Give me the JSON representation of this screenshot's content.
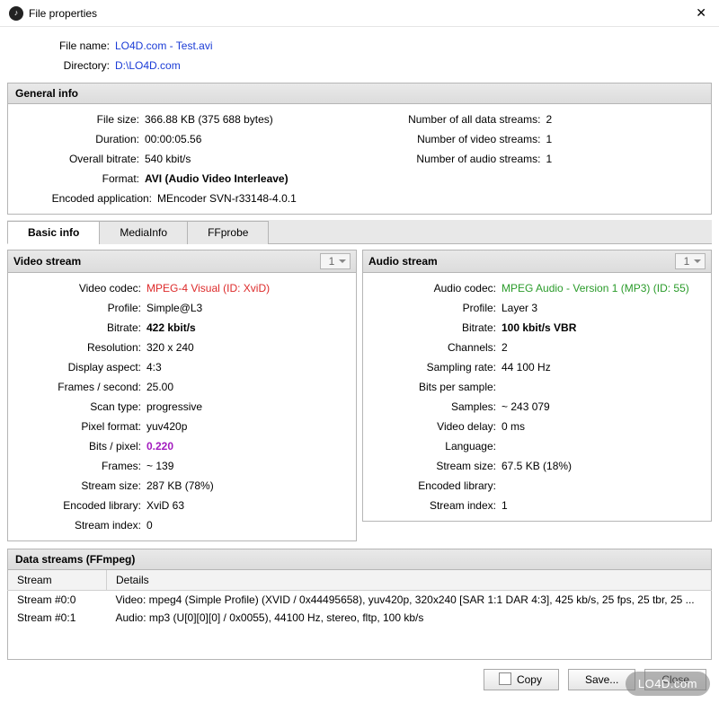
{
  "window": {
    "title": "File properties",
    "close_glyph": "✕",
    "appicon_glyph": "♪"
  },
  "file": {
    "name_label": "File name:",
    "name_value": "LO4D.com - Test.avi",
    "dir_label": "Directory:",
    "dir_value": "D:\\LO4D.com"
  },
  "general": {
    "head": "General info",
    "filesize_label": "File size:",
    "filesize_value": "366.88 KB  (375 688 bytes)",
    "duration_label": "Duration:",
    "duration_value": "00:00:05.56",
    "bitrate_label": "Overall bitrate:",
    "bitrate_value": "540 kbit/s",
    "format_label": "Format:",
    "format_value": "AVI (Audio Video Interleave)",
    "encapp_label": "Encoded application:",
    "encapp_value": "MEncoder SVN-r33148-4.0.1",
    "ndata_label": "Number of all data streams:",
    "ndata_value": "2",
    "nvideo_label": "Number of video streams:",
    "nvideo_value": "1",
    "naudio_label": "Number of audio streams:",
    "naudio_value": "1"
  },
  "tabs": {
    "basic": "Basic info",
    "mediainfo": "MediaInfo",
    "ffprobe": "FFprobe"
  },
  "video": {
    "head": "Video stream",
    "selector": "1",
    "codec_label": "Video codec:",
    "codec_value": "MPEG-4 Visual (ID: XviD)",
    "profile_label": "Profile:",
    "profile_value": "Simple@L3",
    "bitrate_label": "Bitrate:",
    "bitrate_value": "422 kbit/s",
    "res_label": "Resolution:",
    "res_value": "320 x 240",
    "aspect_label": "Display aspect:",
    "aspect_value": "4:3",
    "fps_label": "Frames / second:",
    "fps_value": "25.00",
    "scan_label": "Scan type:",
    "scan_value": "progressive",
    "pix_label": "Pixel format:",
    "pix_value": "yuv420p",
    "bpp_label": "Bits / pixel:",
    "bpp_value": "0.220",
    "frames_label": "Frames:",
    "frames_value": "~ 139",
    "size_label": "Stream size:",
    "size_value": "287 KB (78%)",
    "lib_label": "Encoded library:",
    "lib_value": "XviD 63",
    "idx_label": "Stream index:",
    "idx_value": "0"
  },
  "audio": {
    "head": "Audio stream",
    "selector": "1",
    "codec_label": "Audio codec:",
    "codec_value": "MPEG Audio - Version 1 (MP3) (ID: 55)",
    "profile_label": "Profile:",
    "profile_value": "Layer 3",
    "bitrate_label": "Bitrate:",
    "bitrate_value": "100 kbit/s  VBR",
    "ch_label": "Channels:",
    "ch_value": "2",
    "sr_label": "Sampling rate:",
    "sr_value": "44 100 Hz",
    "bps_label": "Bits per sample:",
    "bps_value": "",
    "samples_label": "Samples:",
    "samples_value": "~ 243 079",
    "delay_label": "Video delay:",
    "delay_value": "0 ms",
    "lang_label": "Language:",
    "lang_value": "",
    "size_label": "Stream size:",
    "size_value": "67.5 KB (18%)",
    "lib_label": "Encoded library:",
    "lib_value": "",
    "idx_label": "Stream index:",
    "idx_value": "1"
  },
  "datastreams": {
    "head": "Data streams   (FFmpeg)",
    "col_stream": "Stream",
    "col_details": "Details",
    "rows": [
      {
        "stream": "Stream #0:0",
        "details": "Video: mpeg4 (Simple Profile) (XVID / 0x44495658), yuv420p, 320x240 [SAR 1:1 DAR 4:3], 425 kb/s, 25 fps, 25 tbr, 25 ..."
      },
      {
        "stream": "Stream #0:1",
        "details": "Audio: mp3 (U[0][0][0] / 0x0055), 44100 Hz, stereo, fltp, 100 kb/s"
      }
    ]
  },
  "buttons": {
    "copy": "Copy",
    "save": "Save...",
    "close": "Close"
  },
  "watermark": "LO4D.com"
}
